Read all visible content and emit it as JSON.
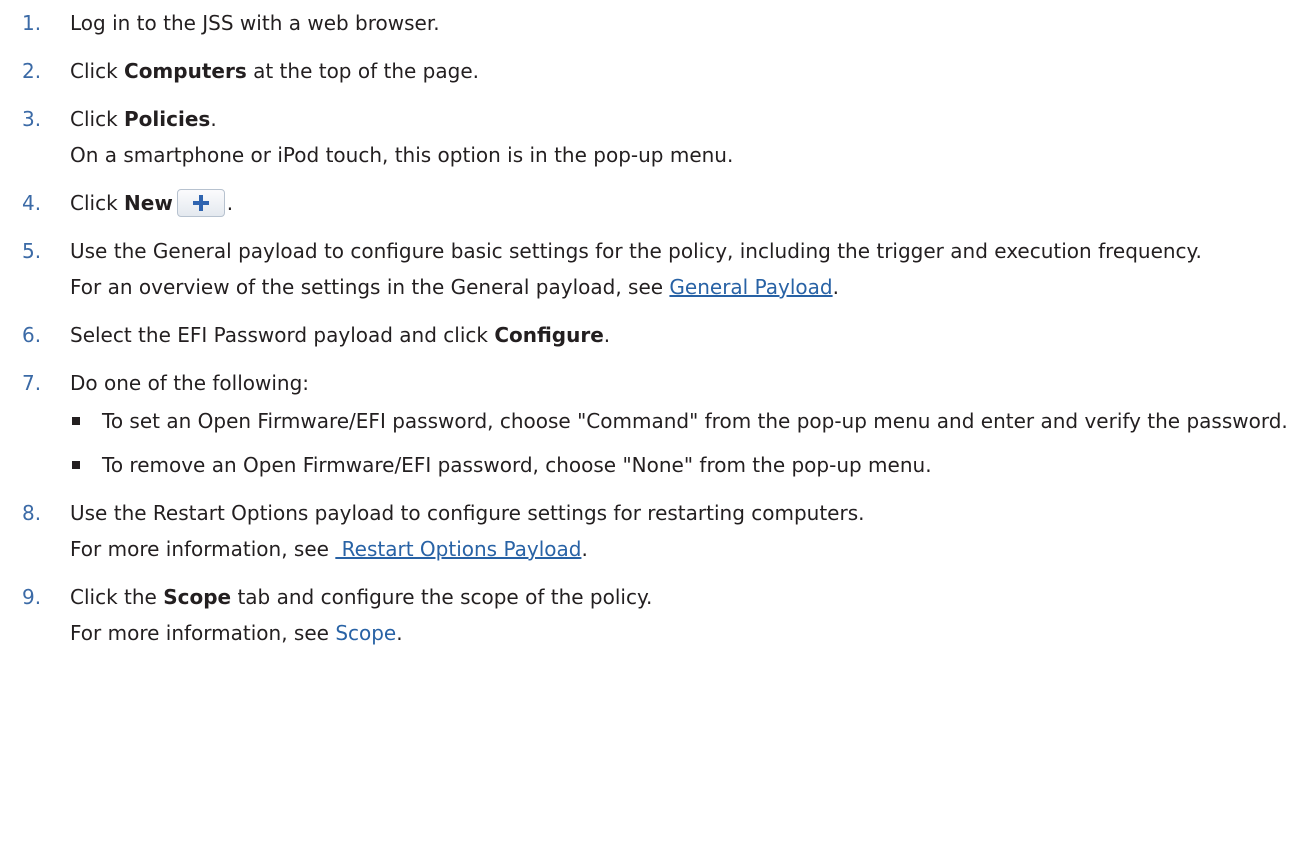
{
  "steps": [
    {
      "num": "1.",
      "pre": "Log in to the JSS with a web browser."
    },
    {
      "num": "2.",
      "pre": "Click ",
      "bold": "Computers",
      "post": " at the top of the page."
    },
    {
      "num": "3.",
      "pre": "Click ",
      "bold": "Policies",
      "post": ".",
      "note": "On a smartphone or iPod touch, this option is in the pop-up menu."
    },
    {
      "num": "4.",
      "pre": "Click ",
      "bold": "New",
      "post": "."
    },
    {
      "num": "5.",
      "pre": "Use the General payload to configure basic settings for the policy, including the trigger and execution frequency.",
      "note_pre": "For an overview of the settings in the General payload, see ",
      "note_link": "General Payload",
      "note_post": "."
    },
    {
      "num": "6.",
      "pre": "Select the EFI Password payload and click ",
      "bold": "Configure",
      "post": "."
    },
    {
      "num": "7.",
      "pre": "Do one of the following:"
    },
    {
      "num": "8.",
      "pre": "Use the Restart Options payload to configure settings for restarting computers.",
      "note_pre": "For more information, see ",
      "note_link": " Restart Options Payload",
      "note_post": "."
    },
    {
      "num": "9.",
      "pre": "Click the ",
      "bold": "Scope",
      "post": " tab and configure the scope of the policy.",
      "note_pre": "For more information, see ",
      "note_link": "Scope",
      "note_post": "."
    }
  ],
  "bullets": [
    "To set an Open Firmware/EFI password, choose \"Command\" from the pop-up menu and enter and verify the password.",
    "To remove an Open Firmware/EFI password, choose \"None\" from the pop-up menu."
  ],
  "icons": {
    "new_button": "plus-icon"
  },
  "colors": {
    "step_number": "#3b6aa6",
    "link": "#2862a5",
    "plus": "#2f64b0"
  }
}
